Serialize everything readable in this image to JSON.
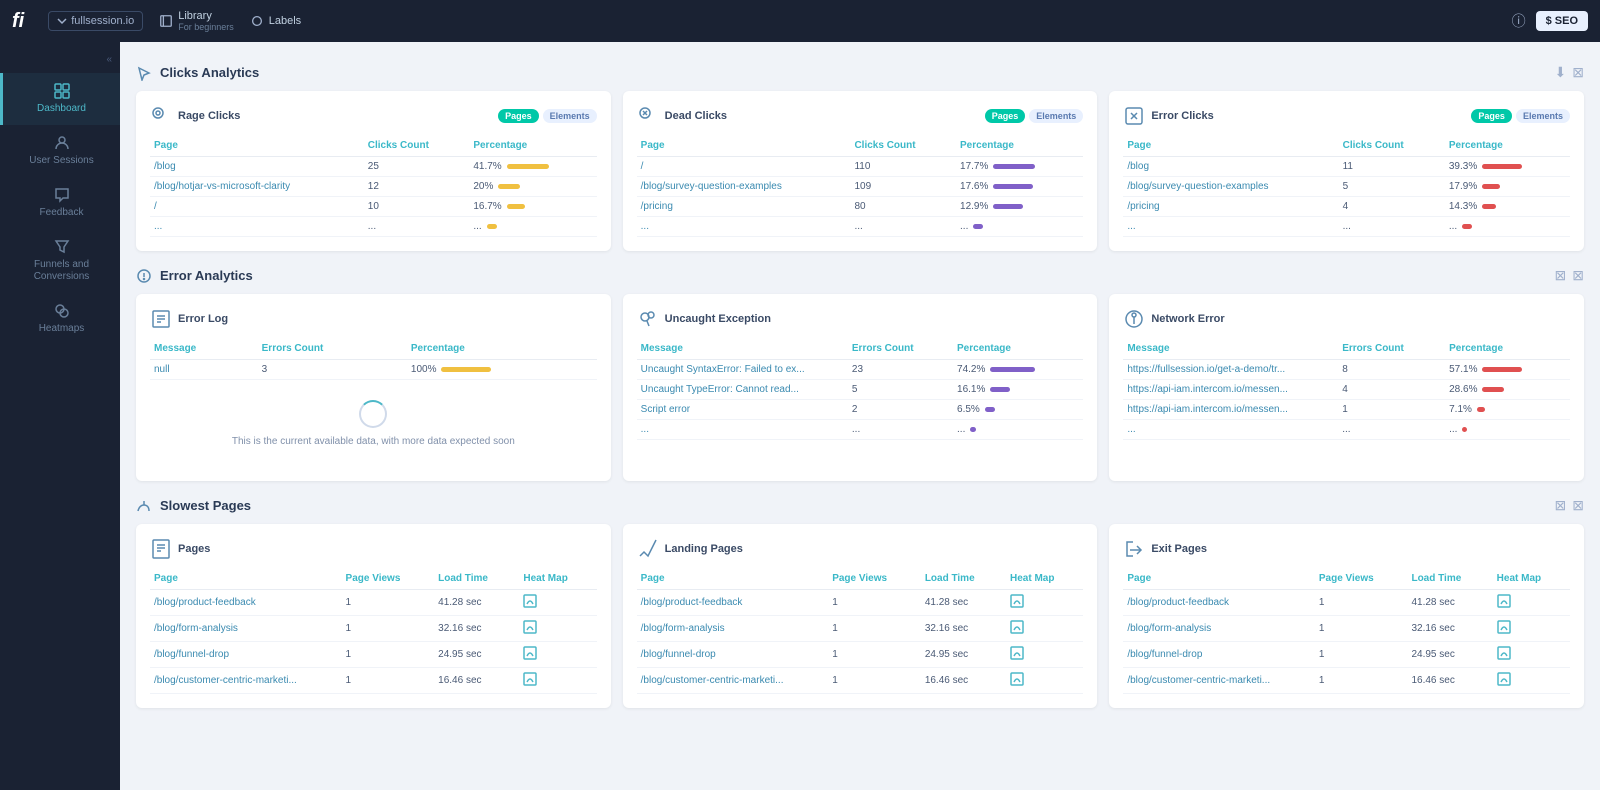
{
  "topnav": {
    "logo": "fi",
    "workspace": "fullsession.io",
    "nav_items": [
      {
        "id": "library",
        "label": "Library",
        "sub": "For beginners"
      },
      {
        "id": "labels",
        "label": "Labels"
      }
    ],
    "info_label": "ⓘ",
    "seo_label": "$ SEO"
  },
  "sidebar": {
    "collapse_hint": "«",
    "items": [
      {
        "id": "dashboard",
        "label": "Dashboard",
        "active": true
      },
      {
        "id": "user-sessions",
        "label": "User Sessions",
        "active": false
      },
      {
        "id": "feedback",
        "label": "Feedback",
        "active": false
      },
      {
        "id": "funnels",
        "label": "Funnels and Conversions",
        "active": false
      },
      {
        "id": "heatmaps",
        "label": "Heatmaps",
        "active": false
      }
    ]
  },
  "sections": {
    "clicks": {
      "title": "Clicks Analytics",
      "cards": [
        {
          "id": "rage-clicks",
          "title": "Rage Clicks",
          "tags": [
            "Pages",
            "Elements"
          ],
          "active_tag": "Pages",
          "columns": [
            "Page",
            "Clicks Count",
            "Percentage"
          ],
          "rows": [
            {
              "page": "/blog",
              "count": "25",
              "pct": "41.7%",
              "bar_width": "42",
              "bar_color": "bar-yellow"
            },
            {
              "page": "/blog/hotjar-vs-microsoft-clarity",
              "count": "12",
              "pct": "20%",
              "bar_width": "22",
              "bar_color": "bar-yellow"
            },
            {
              "page": "/",
              "count": "10",
              "pct": "16.7%",
              "bar_width": "18",
              "bar_color": "bar-yellow"
            },
            {
              "page": "...",
              "count": "...",
              "pct": "...",
              "bar_width": "10",
              "bar_color": "bar-yellow"
            }
          ]
        },
        {
          "id": "dead-clicks",
          "title": "Dead Clicks",
          "tags": [
            "Pages",
            "Elements"
          ],
          "active_tag": "Pages",
          "columns": [
            "Page",
            "Clicks Count",
            "Percentage"
          ],
          "rows": [
            {
              "page": "/",
              "count": "110",
              "pct": "17.7%",
              "bar_width": "42",
              "bar_color": "bar-purple"
            },
            {
              "page": "/blog/survey-question-examples",
              "count": "109",
              "pct": "17.6%",
              "bar_width": "40",
              "bar_color": "bar-purple"
            },
            {
              "page": "/pricing",
              "count": "80",
              "pct": "12.9%",
              "bar_width": "30",
              "bar_color": "bar-purple"
            },
            {
              "page": "...",
              "count": "...",
              "pct": "...",
              "bar_width": "10",
              "bar_color": "bar-purple"
            }
          ]
        },
        {
          "id": "error-clicks",
          "title": "Error Clicks",
          "tags": [
            "Pages",
            "Elements"
          ],
          "active_tag": "Pages",
          "columns": [
            "Page",
            "Clicks Count",
            "Percentage"
          ],
          "rows": [
            {
              "page": "/blog",
              "count": "11",
              "pct": "39.3%",
              "bar_width": "40",
              "bar_color": "bar-red"
            },
            {
              "page": "/blog/survey-question-examples",
              "count": "5",
              "pct": "17.9%",
              "bar_width": "18",
              "bar_color": "bar-red"
            },
            {
              "page": "/pricing",
              "count": "4",
              "pct": "14.3%",
              "bar_width": "14",
              "bar_color": "bar-red"
            },
            {
              "page": "...",
              "count": "...",
              "pct": "...",
              "bar_width": "10",
              "bar_color": "bar-red"
            }
          ]
        }
      ]
    },
    "errors": {
      "title": "Error Analytics",
      "cards": [
        {
          "id": "error-log",
          "title": "Error Log",
          "tags": [],
          "columns": [
            "Message",
            "Errors Count",
            "Percentage"
          ],
          "rows": [
            {
              "page": "null",
              "count": "3",
              "pct": "100%",
              "bar_width": "50",
              "bar_color": "bar-yellow"
            }
          ],
          "empty_state": "This is the current available data, with more data expected soon"
        },
        {
          "id": "uncaught-exception",
          "title": "Uncaught Exception",
          "tags": [],
          "columns": [
            "Message",
            "Errors Count",
            "Percentage"
          ],
          "rows": [
            {
              "page": "Uncaught SyntaxError: Failed to ex...",
              "count": "23",
              "pct": "74.2%",
              "bar_width": "45",
              "bar_color": "bar-purple"
            },
            {
              "page": "Uncaught TypeError: Cannot read...",
              "count": "5",
              "pct": "16.1%",
              "bar_width": "20",
              "bar_color": "bar-purple"
            },
            {
              "page": "Script error",
              "count": "2",
              "pct": "6.5%",
              "bar_width": "10",
              "bar_color": "bar-purple"
            },
            {
              "page": "...",
              "count": "...",
              "pct": "...",
              "bar_width": "6",
              "bar_color": "bar-purple"
            }
          ]
        },
        {
          "id": "network-error",
          "title": "Network Error",
          "tags": [],
          "columns": [
            "Message",
            "Errors Count",
            "Percentage"
          ],
          "rows": [
            {
              "page": "https://fullsession.io/get-a-demo/tr...",
              "count": "8",
              "pct": "57.1%",
              "bar_width": "40",
              "bar_color": "bar-red"
            },
            {
              "page": "https://api-iam.intercom.io/messen...",
              "count": "4",
              "pct": "28.6%",
              "bar_width": "22",
              "bar_color": "bar-red"
            },
            {
              "page": "https://api-iam.intercom.io/messen...",
              "count": "1",
              "pct": "7.1%",
              "bar_width": "8",
              "bar_color": "bar-red"
            },
            {
              "page": "...",
              "count": "...",
              "pct": "...",
              "bar_width": "5",
              "bar_color": "bar-red"
            }
          ]
        }
      ]
    },
    "slowest": {
      "title": "Slowest Pages",
      "cards": [
        {
          "id": "pages",
          "title": "Pages",
          "columns": [
            "Page",
            "Page Views",
            "Load Time",
            "Heat Map"
          ],
          "rows": [
            {
              "page": "/blog/product-feedback",
              "views": "1",
              "time": "41.28 sec"
            },
            {
              "page": "/blog/form-analysis",
              "views": "1",
              "time": "32.16 sec"
            },
            {
              "page": "/blog/funnel-drop",
              "views": "1",
              "time": "24.95 sec"
            },
            {
              "page": "/blog/customer-centric-marketi...",
              "views": "1",
              "time": "16.46 sec"
            }
          ]
        },
        {
          "id": "landing-pages",
          "title": "Landing Pages",
          "columns": [
            "Page",
            "Page Views",
            "Load Time",
            "Heat Map"
          ],
          "rows": [
            {
              "page": "/blog/product-feedback",
              "views": "1",
              "time": "41.28 sec"
            },
            {
              "page": "/blog/form-analysis",
              "views": "1",
              "time": "32.16 sec"
            },
            {
              "page": "/blog/funnel-drop",
              "views": "1",
              "time": "24.95 sec"
            },
            {
              "page": "/blog/customer-centric-marketi...",
              "views": "1",
              "time": "16.46 sec"
            }
          ]
        },
        {
          "id": "exit-pages",
          "title": "Exit Pages",
          "columns": [
            "Page",
            "Page Views",
            "Load Time",
            "Heat Map"
          ],
          "rows": [
            {
              "page": "/blog/product-feedback",
              "views": "1",
              "time": "41.28 sec"
            },
            {
              "page": "/blog/form-analysis",
              "views": "1",
              "time": "32.16 sec"
            },
            {
              "page": "/blog/funnel-drop",
              "views": "1",
              "time": "24.95 sec"
            },
            {
              "page": "/blog/customer-centric-marketi...",
              "views": "1",
              "time": "16.46 sec"
            }
          ]
        }
      ]
    }
  },
  "colors": {
    "accent": "#4db8c8",
    "sidebar_bg": "#1a2233",
    "card_bg": "#ffffff"
  }
}
